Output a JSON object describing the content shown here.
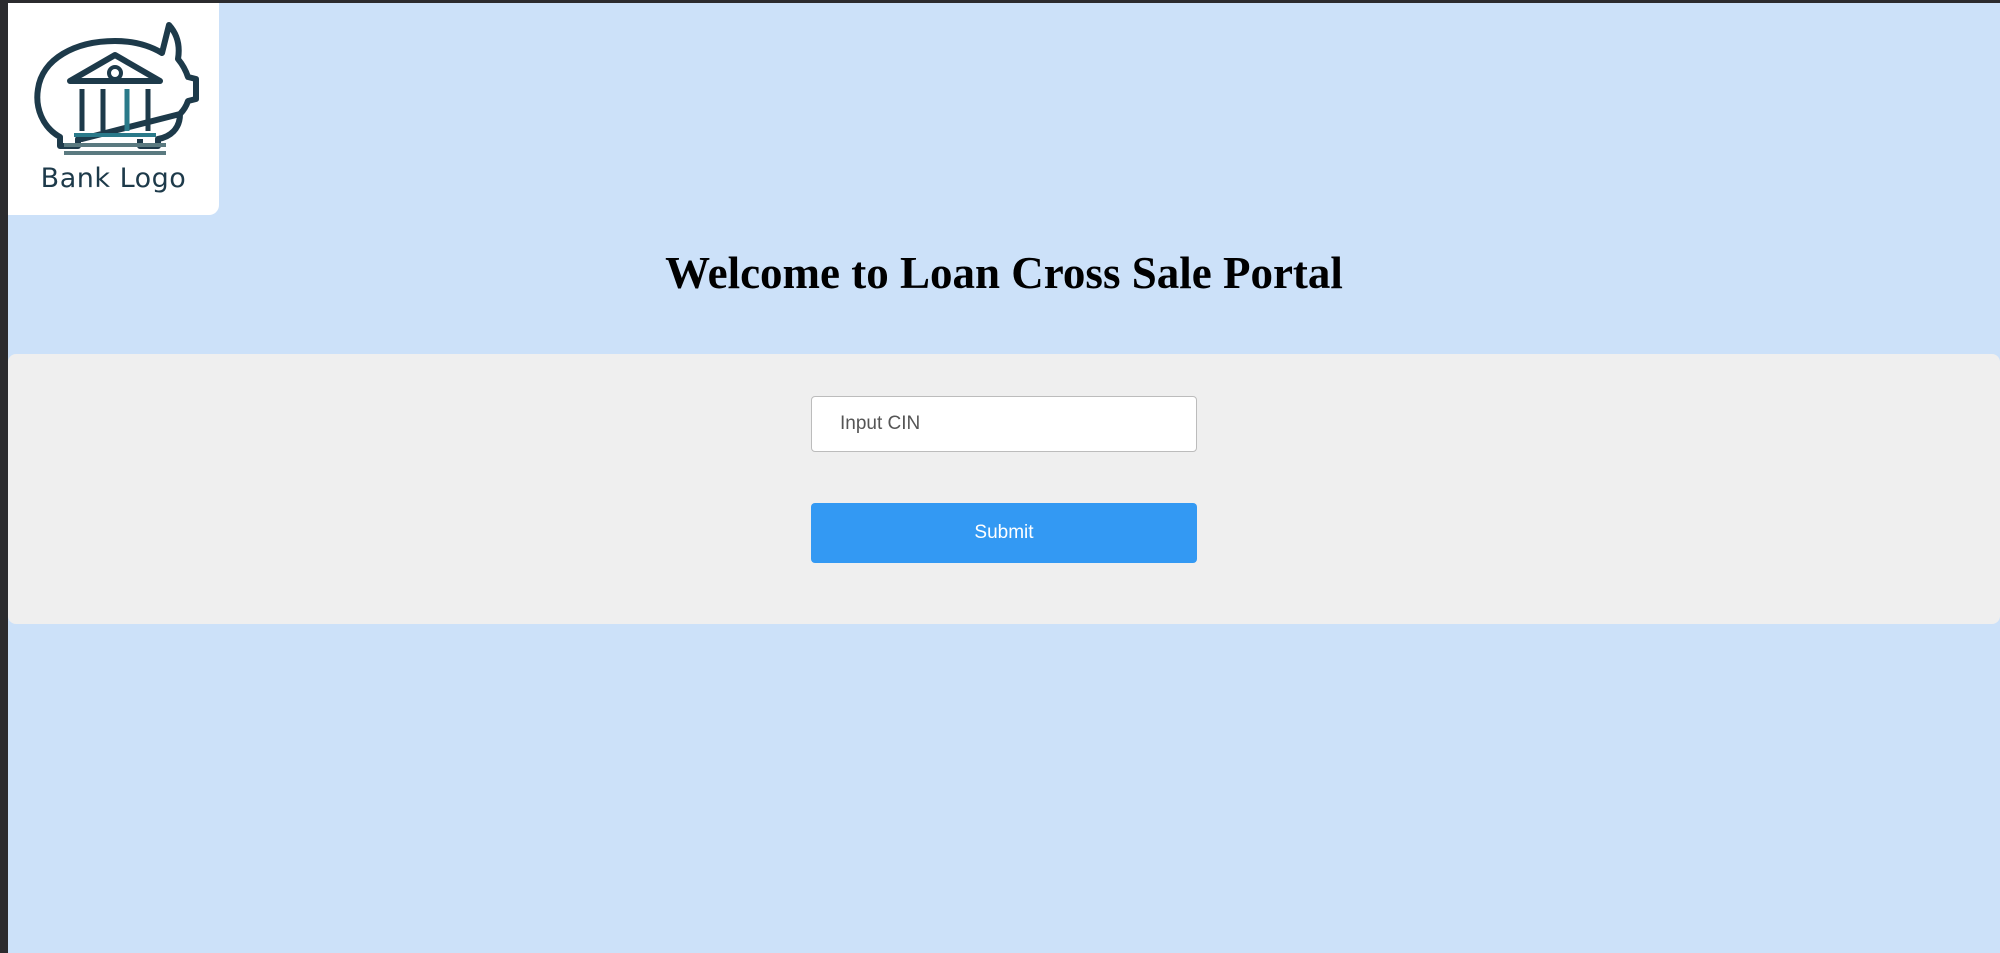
{
  "header": {
    "logo": {
      "icon": "bank-building-piggy-icon",
      "text": "Bank Logo",
      "color": "#1d3a4a"
    },
    "title": "Welcome to Loan Cross Sale Portal"
  },
  "form": {
    "cin_input": {
      "placeholder": "Input CIN",
      "value": ""
    },
    "submit_label": "Submit"
  },
  "colors": {
    "page_background": "#cce1f9",
    "form_band": "#efefef",
    "button": "#3399f3",
    "button_text": "#ffffff"
  }
}
